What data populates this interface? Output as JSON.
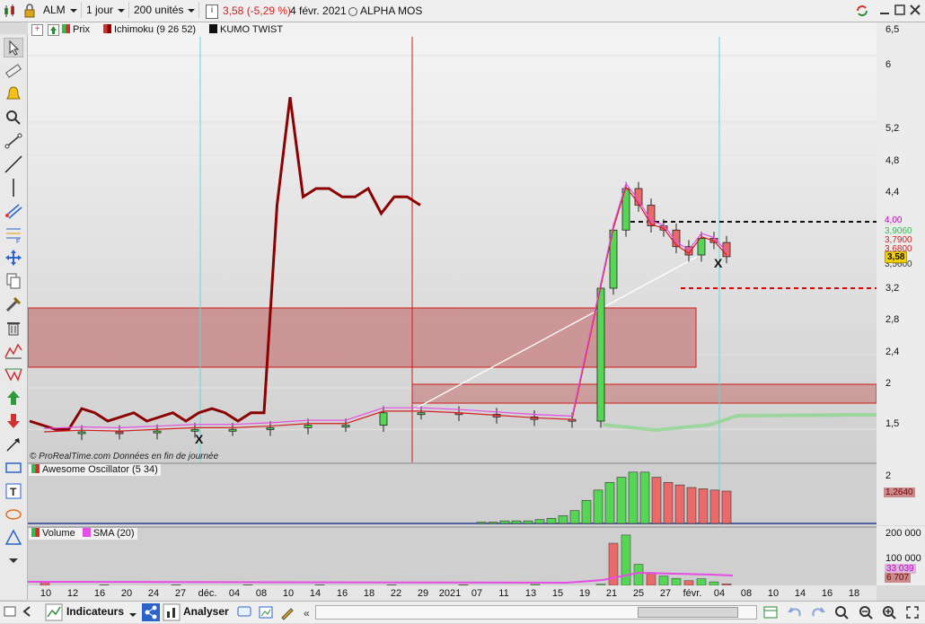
{
  "toolbar": {
    "symbol": "ALM",
    "timeframe": "1 jour",
    "units": "200 unités",
    "price_change": "3,58 (-5,29 %)",
    "date": "4 févr. 2021",
    "instrument_name": "ALPHA MOS"
  },
  "legend": {
    "price": "Prix",
    "ichimoku": "Ichimoku (9 26 52)",
    "kumo": "KUMO TWIST"
  },
  "price_axis": {
    "ticks": [
      "6,5",
      "6",
      "5,2",
      "4,8",
      "4,4",
      "4",
      "3,2",
      "2,8",
      "2,4",
      "2",
      "1,5"
    ],
    "tags": [
      {
        "text": "4,00",
        "color": "#d000d0"
      },
      {
        "text": "3,9060",
        "color": "#2fbf4a"
      },
      {
        "text": "3,7900",
        "color": "#d41e1e"
      },
      {
        "text": "3,6800",
        "color": "#d41e1e"
      },
      {
        "text": "3,5600",
        "color": "#333333"
      },
      {
        "text": "3,58",
        "color": "#111111"
      }
    ]
  },
  "watermark": "© ProRealTime.com  Données en fin de journée",
  "oscillator": {
    "title": "Awesome Oscillator (5 34)",
    "ticks": [
      "2"
    ],
    "tag": "1,2640"
  },
  "volume": {
    "title": "Volume",
    "sma": "SMA (20)",
    "ticks": [
      "200 000",
      "100 000"
    ],
    "tags": [
      "33 039",
      "6 707"
    ]
  },
  "xaxis": {
    "labels": [
      "10",
      "12",
      "16",
      "20",
      "24",
      "27",
      "déc.",
      "04",
      "08",
      "10",
      "14",
      "16",
      "18",
      "22",
      "29",
      "2021",
      "07",
      "11",
      "13",
      "15",
      "19",
      "21",
      "25",
      "27",
      "févr.",
      "04",
      "08",
      "10",
      "14",
      "16",
      "18"
    ]
  },
  "chart_data": {
    "type": "candlestick",
    "title": "ALM",
    "period": "1 jour",
    "kumo_twist_markers": [
      "X",
      "X"
    ],
    "ichimoku_chikou": [
      1.6,
      1.55,
      1.5,
      1.5,
      1.75,
      1.7,
      1.6,
      1.65,
      1.7,
      1.6,
      1.65,
      1.7,
      1.6,
      1.7,
      1.75,
      1.7,
      1.6,
      1.7,
      1.7,
      4.2,
      5.5,
      4.3,
      4.4,
      4.4,
      4.3,
      4.3,
      4.4,
      4.1,
      4.3,
      4.3,
      4.2
    ],
    "price_path": [
      1.45,
      1.47,
      1.46,
      1.48,
      1.5,
      1.5,
      1.52,
      1.55,
      1.55,
      1.7,
      1.7,
      1.68,
      1.65,
      1.62,
      1.6,
      3.2,
      3.9,
      4.4,
      4.2,
      3.95,
      3.9,
      3.7,
      3.6,
      3.8,
      3.75,
      3.58
    ],
    "horizontal_levels": [
      {
        "value": 4.0,
        "style": "dashed",
        "color": "#000000"
      },
      {
        "value": 3.2,
        "style": "dashed",
        "color": "#e00000"
      }
    ],
    "zones": [
      {
        "from": 2.2,
        "to": 2.95
      },
      {
        "from": 1.75,
        "to": 2.0
      }
    ],
    "awesome_oscillator": [
      0.05,
      0.05,
      0.1,
      0.1,
      0.1,
      0.15,
      0.2,
      0.3,
      0.5,
      0.9,
      1.3,
      1.6,
      1.8,
      2.0,
      2.0,
      1.8,
      1.6,
      1.5,
      1.4,
      1.35,
      1.3,
      1.26
    ],
    "volume_sma20": 33039,
    "volume_last": 6707
  },
  "bottom": {
    "indicators": "Indicateurs",
    "analyser": "Analyser"
  }
}
